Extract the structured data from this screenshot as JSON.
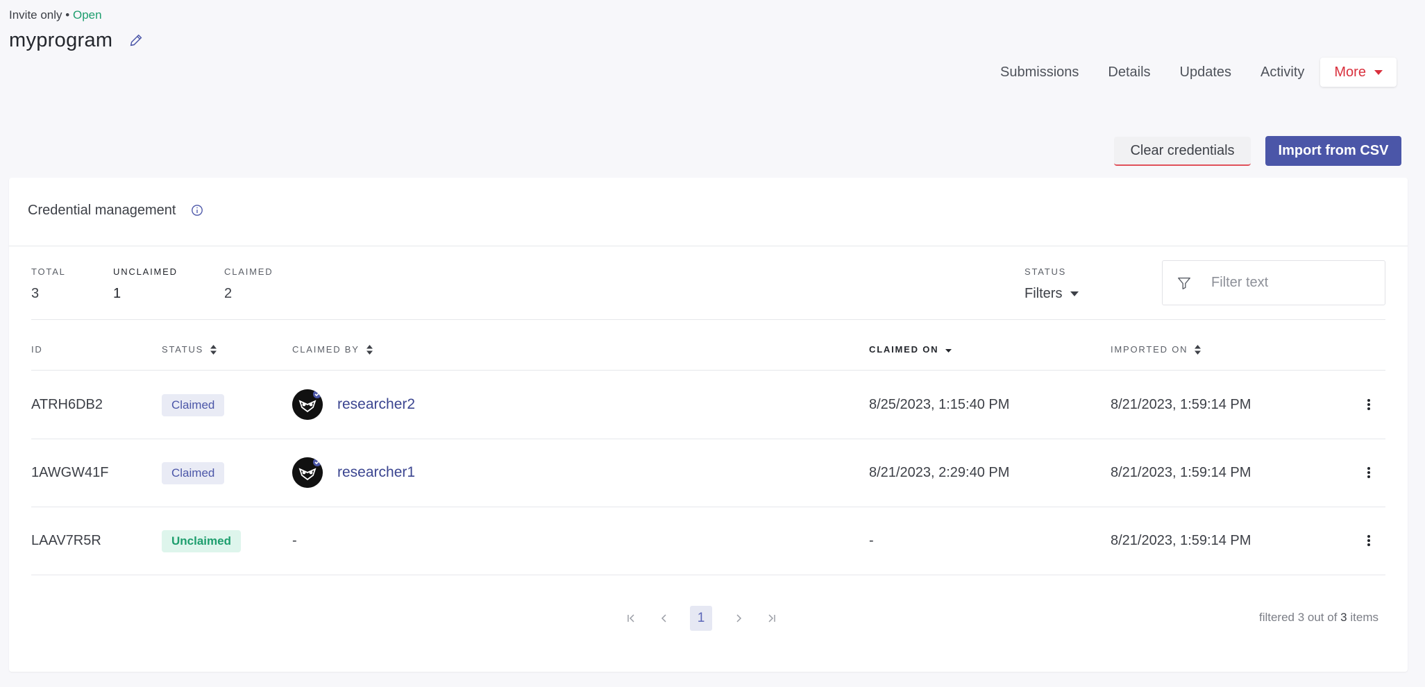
{
  "header": {
    "access": "Invite only",
    "bullet": "•",
    "state": "Open",
    "program_name": "myprogram"
  },
  "nav": {
    "items": [
      "Submissions",
      "Details",
      "Updates",
      "Activity"
    ],
    "more_label": "More"
  },
  "actions": {
    "clear_label": "Clear credentials",
    "import_label": "Import from CSV"
  },
  "card": {
    "title": "Credential management"
  },
  "stats": {
    "total_label": "TOTAL",
    "total_value": "3",
    "unclaimed_label": "UNCLAIMED",
    "unclaimed_value": "1",
    "claimed_label": "CLAIMED",
    "claimed_value": "2"
  },
  "filter": {
    "status_label": "STATUS",
    "filters_label": "Filters",
    "placeholder": "Filter text"
  },
  "table": {
    "columns": {
      "id": "ID",
      "status": "STATUS",
      "claimed_by": "CLAIMED BY",
      "claimed_on": "CLAIMED ON",
      "imported_on": "IMPORTED ON"
    },
    "rows": [
      {
        "id": "ATRH6DB2",
        "status": "Claimed",
        "claimed_by": "researcher2",
        "claimed_on": "8/25/2023, 1:15:40 PM",
        "imported_on": "8/21/2023, 1:59:14 PM"
      },
      {
        "id": "1AWGW41F",
        "status": "Claimed",
        "claimed_by": "researcher1",
        "claimed_on": "8/21/2023, 2:29:40 PM",
        "imported_on": "8/21/2023, 1:59:14 PM"
      },
      {
        "id": "LAAV7R5R",
        "status": "Unclaimed",
        "claimed_by": "-",
        "claimed_on": "-",
        "imported_on": "8/21/2023, 1:59:14 PM"
      }
    ]
  },
  "pagination": {
    "current_page": "1",
    "summary_prefix": "filtered 3 out of",
    "summary_total": "3",
    "summary_suffix": "items"
  },
  "colors": {
    "accent": "#4b56a8",
    "danger": "#d9303d",
    "success": "#1e9e6e",
    "background": "#f7f7fa"
  }
}
